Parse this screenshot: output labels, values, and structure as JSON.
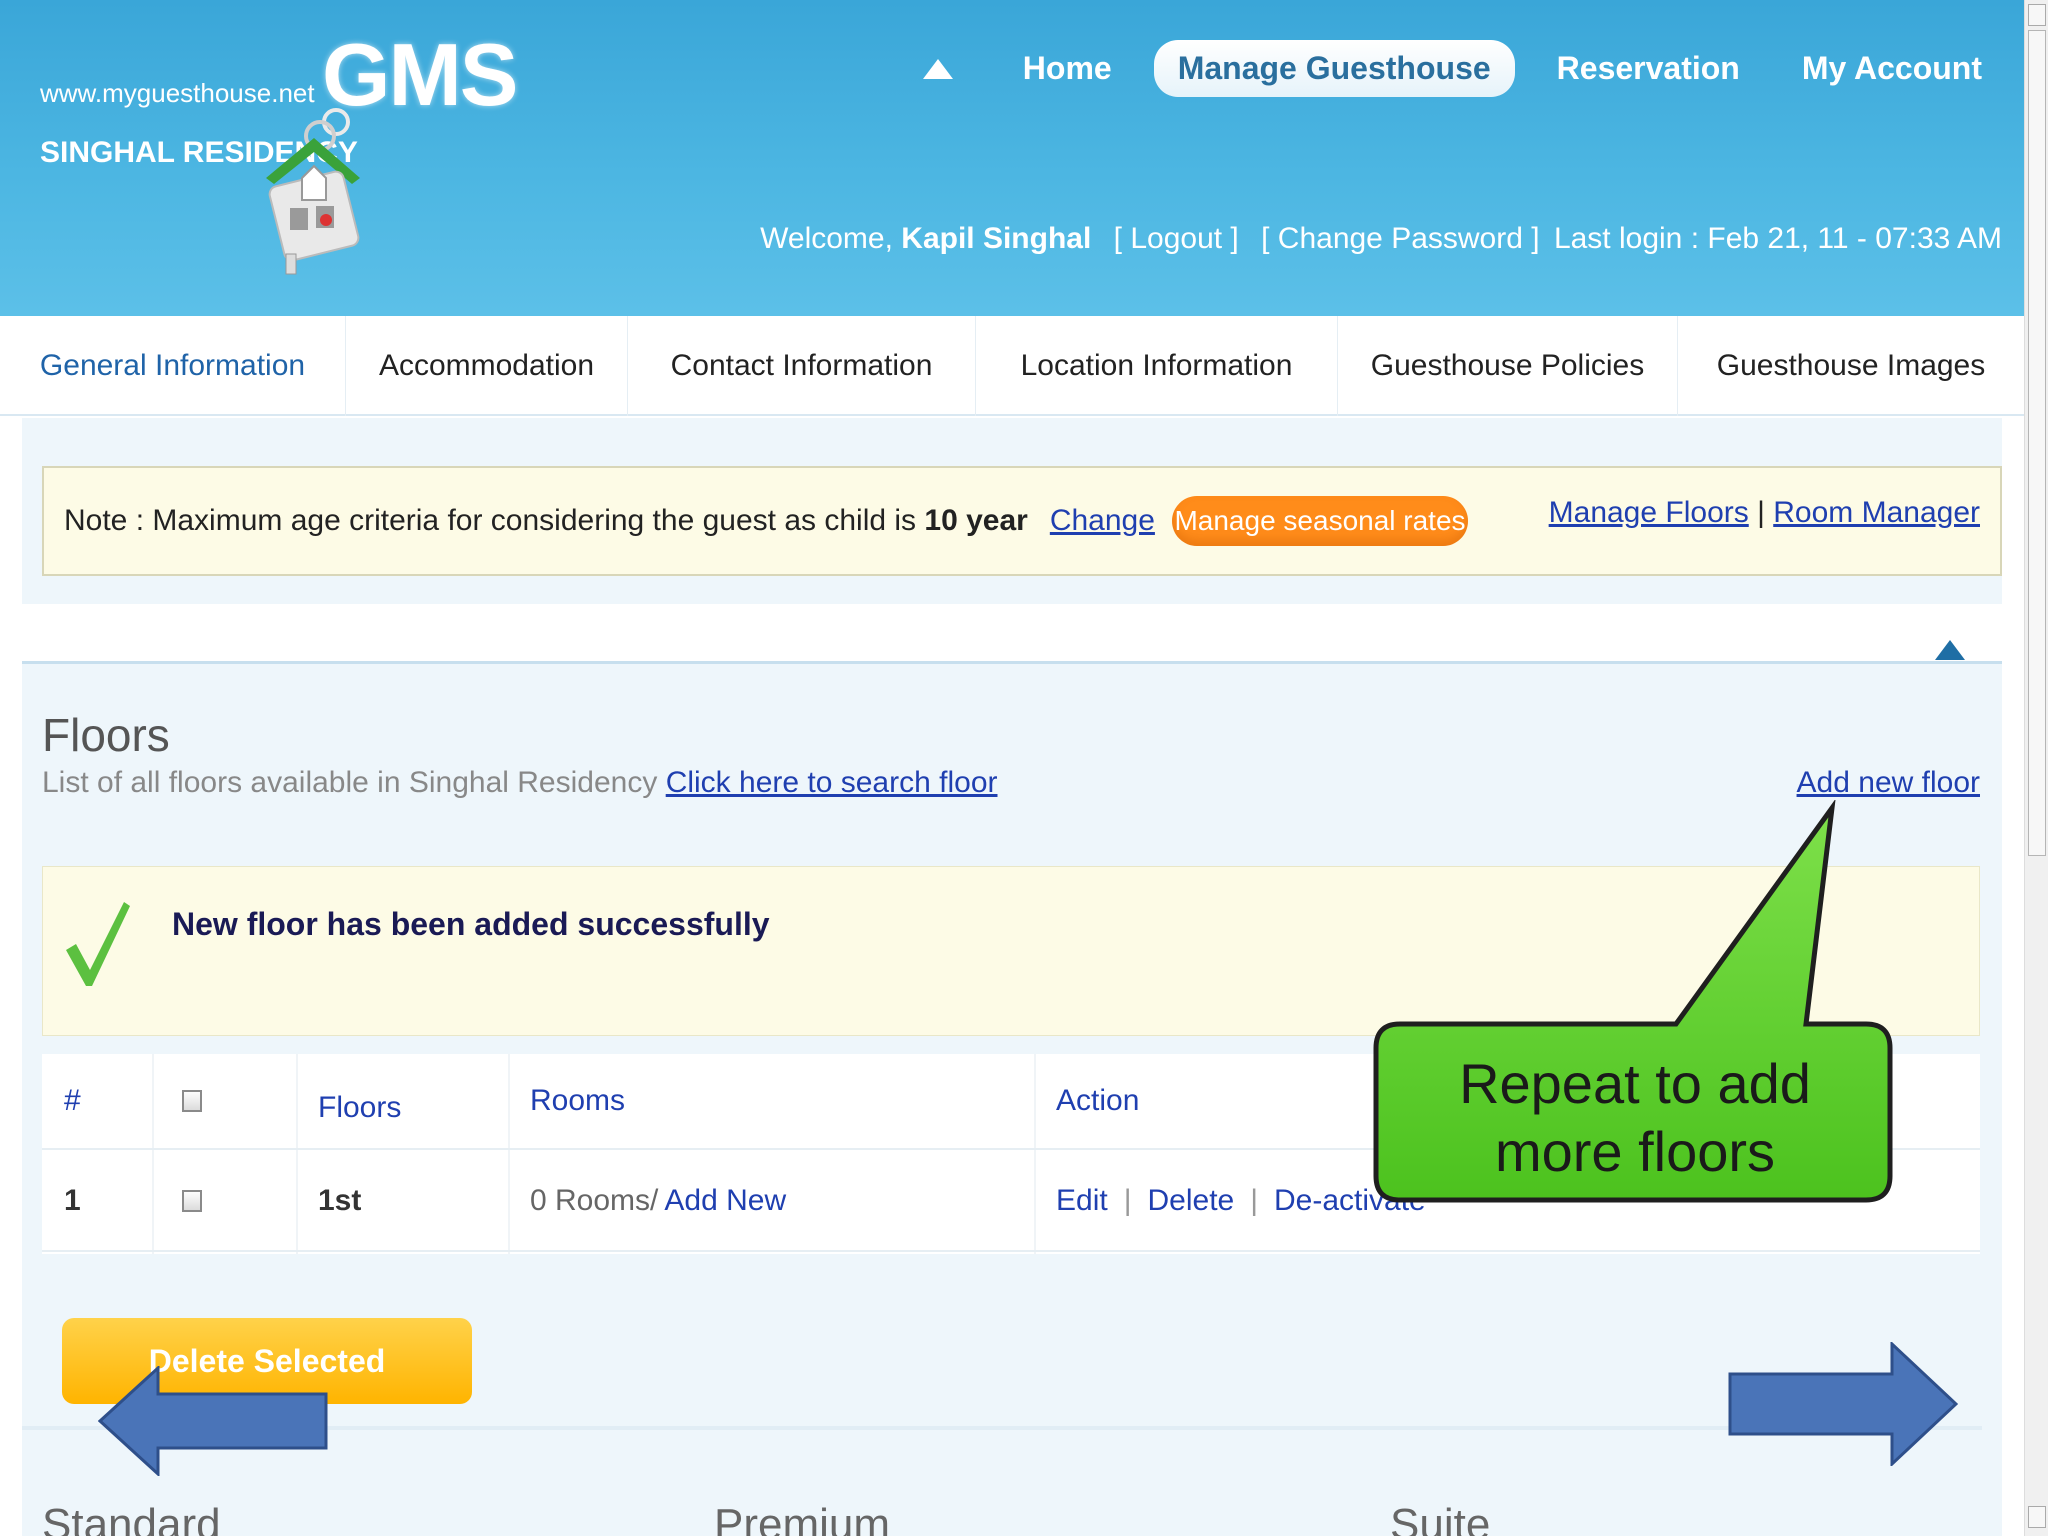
{
  "header": {
    "site_url": "www.myguesthouse.net",
    "brand": "GMS",
    "residency": "SINGHAL RESIDENCY",
    "nav": [
      "Home",
      "Manage Guesthouse",
      "Reservation",
      "My Account"
    ],
    "nav_active": "Manage Guesthouse",
    "welcome": "Welcome,",
    "user": "Kapil Singhal",
    "logout": "[ Logout ]",
    "change_password": "[ Change Password ]",
    "last_login": "Last login : Feb 21, 11 - 07:33 AM"
  },
  "tabs": [
    "General Information",
    "Accommodation",
    "Contact Information",
    "Location Information",
    "Guesthouse Policies",
    "Guesthouse Images"
  ],
  "note": {
    "text": "Note : Maximum age criteria for considering the guest as child is",
    "value": "10 year",
    "change": "Change",
    "seasonal_button": "Manage seasonal rates",
    "manage_floors": "Manage Floors",
    "separator": "|",
    "room_manager": "Room Manager"
  },
  "floors": {
    "title": "Floors",
    "subtitle": "List of all floors available in Singhal Residency",
    "search_link": "Click here to search floor",
    "add_link": "Add new floor",
    "success_message": "New floor has been added successfully",
    "columns": [
      "#",
      "Floors",
      "Rooms",
      "Action"
    ],
    "rows": [
      {
        "num": "1",
        "floor": "1st",
        "rooms": "0 Rooms/",
        "add_new": "Add New",
        "actions": [
          "Edit",
          "Delete",
          "De-activate"
        ]
      }
    ],
    "delete_selected": "Delete Selected"
  },
  "bottom_sections": [
    "Standard",
    "Premium",
    "Suite"
  ],
  "callout": {
    "text": "Repeat to add more floors"
  },
  "colors": {
    "header": "#4cb6e2",
    "accent_orange": "#ff8c1a",
    "callout_green": "#5fd12e",
    "arrow_blue": "#4a74b8",
    "link_blue": "#1f3fb0"
  }
}
